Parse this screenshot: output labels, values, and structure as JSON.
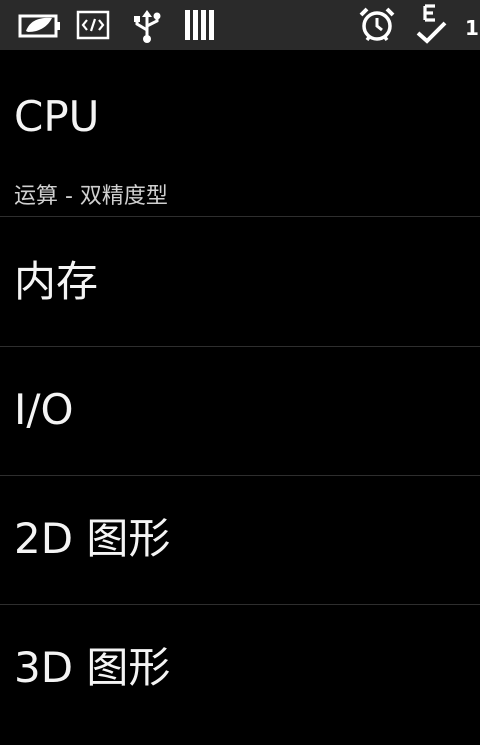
{
  "status_bar": {
    "icons": [
      "battery-leaf-icon",
      "code-icon",
      "usb-icon",
      "signal-bars-icon",
      "alarm-clock-icon",
      "e-check-icon"
    ],
    "clock": "1:"
  },
  "menu": {
    "items": [
      {
        "label": "CPU",
        "subtitle": "运算 - 双精度型"
      },
      {
        "label": "内存"
      },
      {
        "label": "I/O"
      },
      {
        "label": "2D 图形"
      },
      {
        "label": "3D 图形"
      }
    ]
  }
}
